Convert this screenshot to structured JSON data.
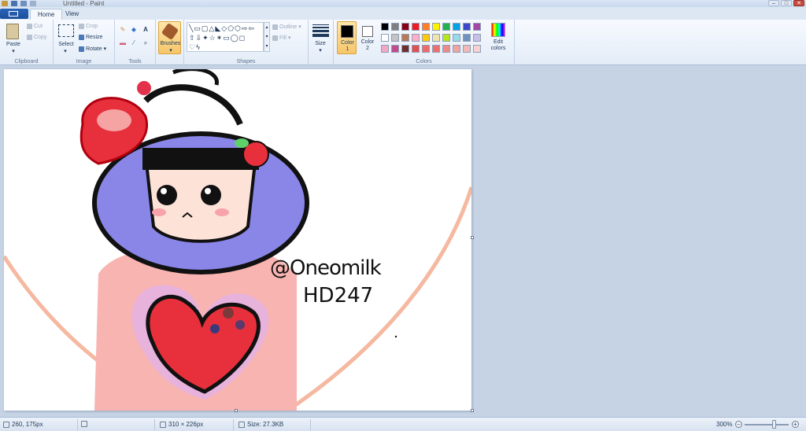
{
  "window": {
    "title": "Untitled - Paint",
    "min": "–",
    "max": "□",
    "close": "✕"
  },
  "tabs": [
    {
      "label": "Home"
    },
    {
      "label": "View"
    }
  ],
  "clipboard": {
    "paste": "Paste",
    "cut": "Cut",
    "copy": "Copy",
    "group": "Clipboard"
  },
  "image": {
    "select": "Select",
    "crop": "Crop",
    "resize": "Resize",
    "rotate": "Rotate",
    "group": "Image"
  },
  "tools": {
    "group": "Tools",
    "text_glyph": "A"
  },
  "brushes": {
    "label": "Brushes"
  },
  "shapes": {
    "outline": "Outline",
    "fill": "Fill",
    "group": "Shapes"
  },
  "size": {
    "label": "Size"
  },
  "colors": {
    "color1": "Color",
    "color1_num": "1",
    "color2": "Color",
    "color2_num": "2",
    "edit1": "Edit",
    "edit2": "colors",
    "group": "Colors",
    "row1": [
      "#000000",
      "#7f7f7f",
      "#880015",
      "#ed1c24",
      "#ff7f27",
      "#fff200",
      "#22b14c",
      "#00a2e8",
      "#3f48cc",
      "#a349a4"
    ],
    "row2": [
      "#ffffff",
      "#c3c3c3",
      "#b97a57",
      "#ffaec9",
      "#ffc90e",
      "#efe4b0",
      "#b5e61d",
      "#99d9ea",
      "#7092be",
      "#c8bfe7"
    ],
    "row3": [
      "#f2a7c3",
      "#c24b8e",
      "#6b2f2f",
      "#e05050",
      "#f06a6a",
      "#ea7070",
      "#ef8a8a",
      "#f0a3a3",
      "#f3b8b8",
      "#f8d2d2"
    ],
    "active1": "#000000",
    "active2": "#ffffff"
  },
  "canvas": {
    "watermark1": "@Oneomilk",
    "watermark2": "HD247"
  },
  "status": {
    "cursor": "260, 175px",
    "dims": "310 × 226px",
    "size": "Size: 27.3KB",
    "zoom": "300%",
    "minus": "–",
    "plus": "+"
  }
}
